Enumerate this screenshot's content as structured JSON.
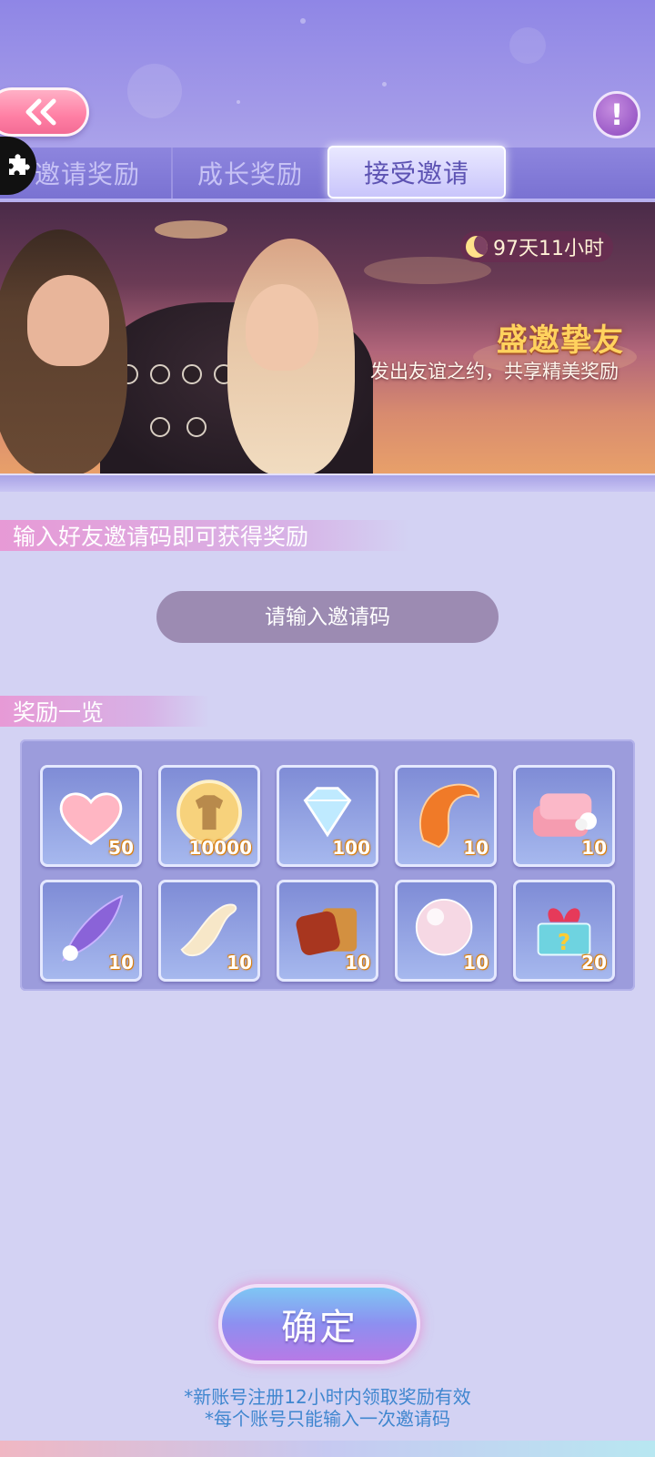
{
  "header": {
    "back_icon": "double-chevron-left-icon",
    "info_icon": "exclamation-icon",
    "info_symbol": "!",
    "side_icon": "puzzle-icon"
  },
  "tabs": [
    {
      "label": "邀请奖励",
      "active": false
    },
    {
      "label": "成长奖励",
      "active": false
    },
    {
      "label": "接受邀请",
      "active": true
    }
  ],
  "banner": {
    "timer": "97天11小时",
    "title": "盛邀挚友",
    "subtitle": "发出友谊之约，共享精美奖励"
  },
  "invite": {
    "section_label": "输入好友邀请码即可获得奖励",
    "placeholder": "请输入邀请码",
    "value": ""
  },
  "rewards": {
    "section_label": "奖励一览",
    "items": [
      {
        "icon": "heart-icon",
        "count": "50"
      },
      {
        "icon": "tshirt-coin-icon",
        "count": "10000"
      },
      {
        "icon": "diamond-icon",
        "count": "100"
      },
      {
        "icon": "fox-fur-icon",
        "count": "10"
      },
      {
        "icon": "fabric-roll-icon",
        "count": "10"
      },
      {
        "icon": "purple-feather-icon",
        "count": "10"
      },
      {
        "icon": "silk-ribbon-icon",
        "count": "10"
      },
      {
        "icon": "leather-icon",
        "count": "10"
      },
      {
        "icon": "pearl-icon",
        "count": "10"
      },
      {
        "icon": "mystery-gift-icon",
        "count": "20"
      }
    ]
  },
  "confirm": {
    "label": "确定"
  },
  "notes": [
    "*新账号注册12小时内领取奖励有效",
    "*每个账号只能输入一次邀请码"
  ]
}
